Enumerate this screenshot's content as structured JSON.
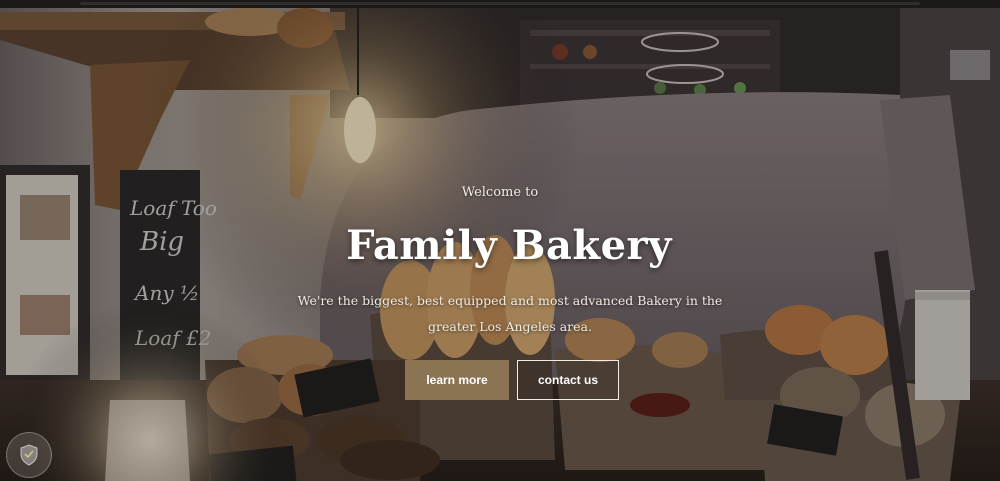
{
  "hero": {
    "welcome": "Welcome to",
    "title": "Family Bakery",
    "tagline": "We're the biggest, best equipped and most advanced Bakery in the greater Los Angeles area."
  },
  "buttons": {
    "primary_label": "learn more",
    "secondary_label": "contact us"
  },
  "colors": {
    "accent": "#8a7453",
    "button_text": "#ffffff"
  },
  "icons": {
    "corner_badge": "shield-icon"
  }
}
